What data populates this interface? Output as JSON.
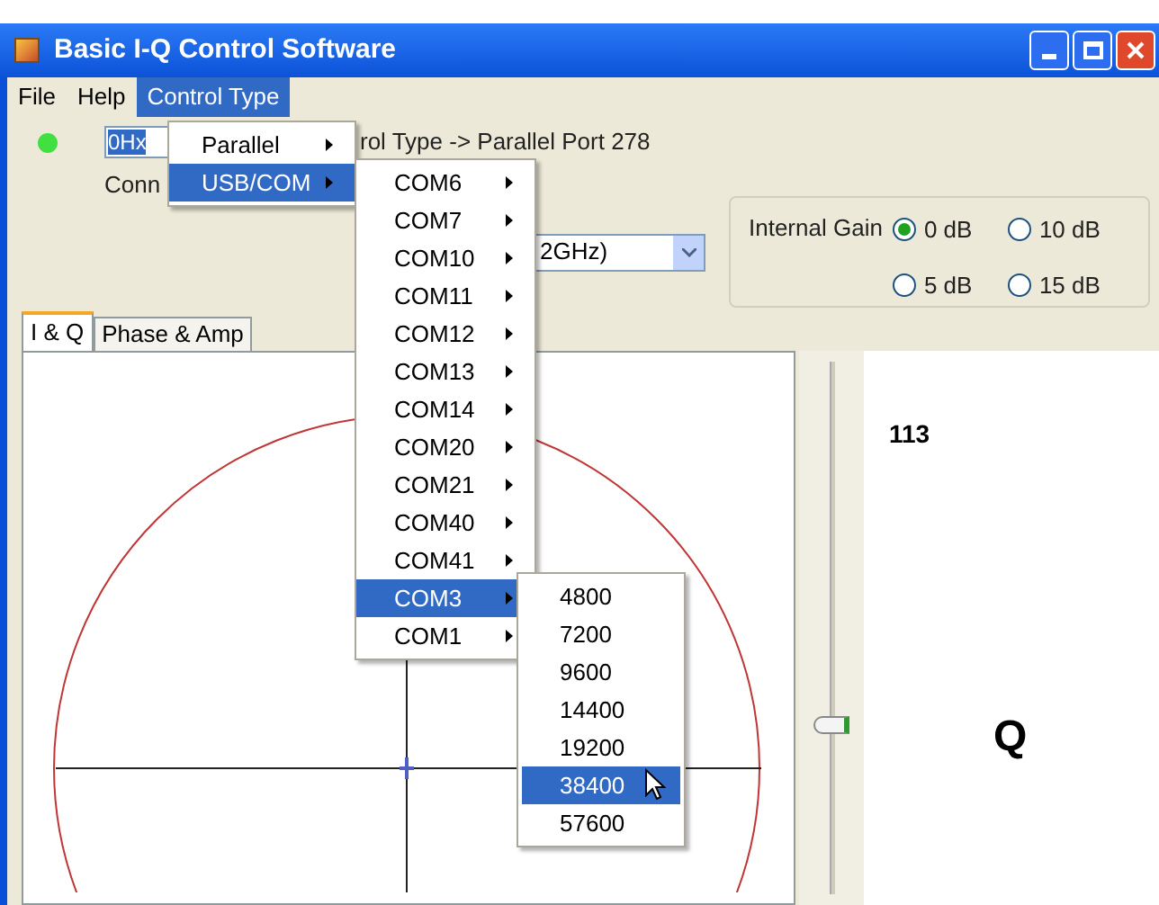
{
  "window": {
    "title": "Basic I-Q Control Software"
  },
  "menu_bar": [
    {
      "label": "File",
      "selected": false
    },
    {
      "label": "Help",
      "selected": false
    },
    {
      "label": "Control Type",
      "selected": true
    }
  ],
  "open_menu": [
    {
      "label": "Parallel",
      "selected": false,
      "submenu": true
    },
    {
      "label": "USB/COM",
      "selected": true,
      "submenu": true,
      "children": [
        {
          "label": "COM6",
          "selected": false,
          "submenu": true
        },
        {
          "label": "COM7",
          "selected": false,
          "submenu": true
        },
        {
          "label": "COM10",
          "selected": false,
          "submenu": true
        },
        {
          "label": "COM11",
          "selected": false,
          "submenu": true
        },
        {
          "label": "COM12",
          "selected": false,
          "submenu": true
        },
        {
          "label": "COM13",
          "selected": false,
          "submenu": true
        },
        {
          "label": "COM14",
          "selected": false,
          "submenu": true
        },
        {
          "label": "COM20",
          "selected": false,
          "submenu": true
        },
        {
          "label": "COM21",
          "selected": false,
          "submenu": true
        },
        {
          "label": "COM40",
          "selected": false,
          "submenu": true
        },
        {
          "label": "COM41",
          "selected": false,
          "submenu": true
        },
        {
          "label": "COM3",
          "selected": true,
          "submenu": true,
          "children": [
            {
              "label": "4800",
              "selected": false,
              "submenu": false
            },
            {
              "label": "7200",
              "selected": false,
              "submenu": false
            },
            {
              "label": "9600",
              "selected": false,
              "submenu": false
            },
            {
              "label": "14400",
              "selected": false,
              "submenu": false
            },
            {
              "label": "19200",
              "selected": false,
              "submenu": false
            },
            {
              "label": "38400",
              "selected": true,
              "submenu": false
            },
            {
              "label": "57600",
              "selected": false,
              "submenu": false
            }
          ]
        },
        {
          "label": "COM1",
          "selected": false,
          "submenu": true
        }
      ]
    }
  ],
  "status_led": {
    "on": true
  },
  "address_field": {
    "value": "0Hx"
  },
  "control_type_label": "rol Type -> Parallel Port 278",
  "connection_label": "Conn",
  "frequency_dropdown": {
    "value": "2GHz)"
  },
  "internal_gain": {
    "label": "Internal Gain",
    "options": [
      {
        "label": "0 dB",
        "selected": true
      },
      {
        "label": "10 dB",
        "selected": false
      },
      {
        "label": "5 dB",
        "selected": false
      },
      {
        "label": "15 dB",
        "selected": false
      }
    ]
  },
  "tabs": [
    {
      "label": "I & Q",
      "selected": true
    },
    {
      "label": "Phase & Amp",
      "selected": false
    }
  ],
  "q_slider": {
    "level": 0.3
  },
  "q_value": "113",
  "q_label": "Q"
}
